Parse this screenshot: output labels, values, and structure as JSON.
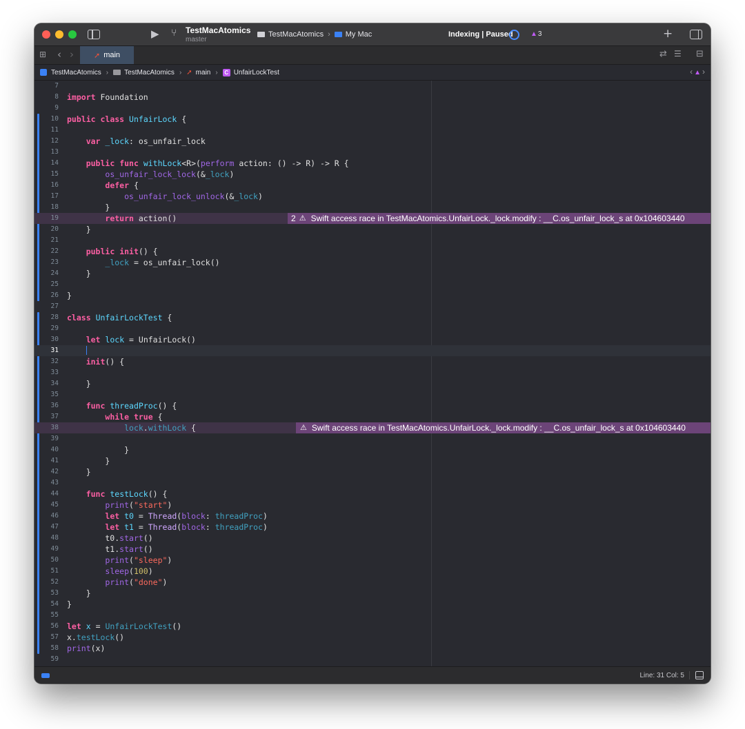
{
  "titlebar": {
    "project_name": "TestMacAtomics",
    "branch": "master",
    "scheme": "TestMacAtomics",
    "destination": "My Mac",
    "activity": "Indexing | Paused",
    "warning_count": "3"
  },
  "tab": {
    "label": "main"
  },
  "jumpbar": {
    "crumbs": [
      "TestMacAtomics",
      "TestMacAtomics",
      "main",
      "UnfairLockTest"
    ]
  },
  "editor": {
    "current_line": 31,
    "line_numbers": [
      "7",
      "8",
      "9",
      "10",
      "11",
      "12",
      "13",
      "14",
      "15",
      "16",
      "17",
      "18",
      "19",
      "20",
      "21",
      "22",
      "23",
      "24",
      "25",
      "26",
      "27",
      "28",
      "29",
      "30",
      "31",
      "32",
      "33",
      "34",
      "35",
      "36",
      "37",
      "38",
      "39",
      "40",
      "41",
      "42",
      "43",
      "44",
      "45",
      "46",
      "47",
      "48",
      "49",
      "50",
      "51",
      "52",
      "53",
      "54",
      "55",
      "56",
      "57",
      "58",
      "59"
    ],
    "issues": [
      {
        "line": 19,
        "count": "2",
        "message": "Swift access race in TestMacAtomics.UnfairLock._lock.modify : __C.os_unfair_lock_s at 0x104603440"
      },
      {
        "line": 38,
        "count": "",
        "message": "Swift access race in TestMacAtomics.UnfairLock._lock.modify : __C.os_unfair_lock_s at 0x104603440"
      }
    ]
  },
  "statusbar": {
    "position": "Line: 31  Col: 5"
  },
  "colors": {
    "keyword": "#fc5fa3",
    "type_declaration": "#5dd8ff",
    "string": "#fc6a5d",
    "number": "#d0bf69",
    "issue_highlight": "#6c4478",
    "accent": "#3b82f6"
  },
  "icons": [
    "close-button",
    "minimize-button",
    "zoom-button",
    "sidebar-icon",
    "run-icon",
    "branch-icon",
    "terminal-icon",
    "mac-icon",
    "spinner-icon",
    "warning-icon",
    "plus-icon",
    "inspector-icon",
    "grid-icon",
    "chevron-left-icon",
    "chevron-right-icon",
    "swift-icon",
    "refresh-icon",
    "adjust-editor-icon",
    "add-editor-icon",
    "app-icon",
    "folder-icon",
    "class-icon",
    "debug-area-icon"
  ]
}
